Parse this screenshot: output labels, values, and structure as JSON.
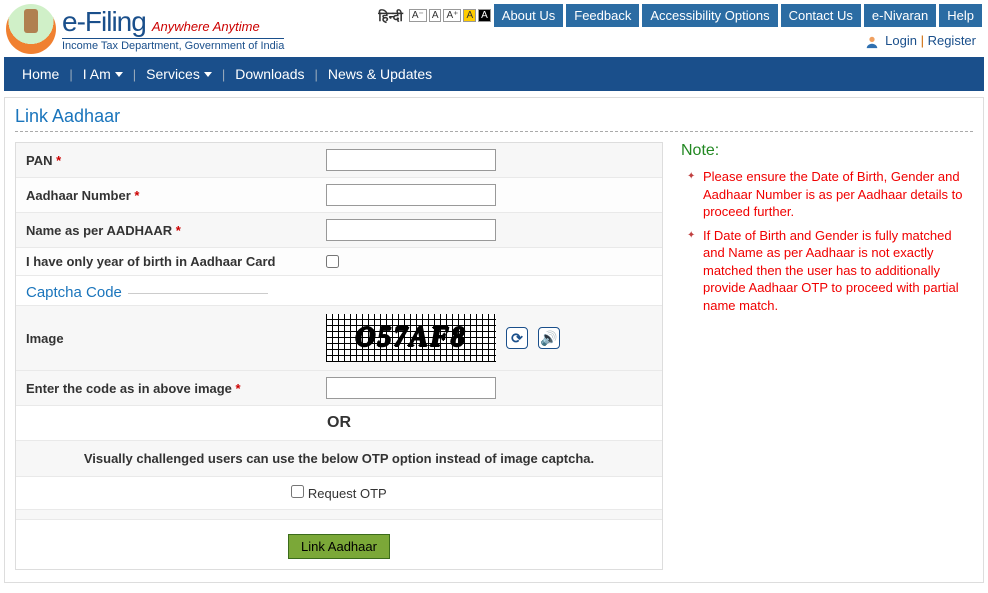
{
  "brand": {
    "efiling": "e-Filing",
    "tagline": "Anywhere Anytime",
    "sub": "Income Tax Department, Government of India"
  },
  "header": {
    "hindi": "हिन्दी",
    "font_minus": "A⁻",
    "font_a1": "A",
    "font_plus": "A⁺",
    "font_yellow": "A",
    "font_black": "A",
    "btns": {
      "about": "About Us",
      "feedback": "Feedback",
      "access": "Accessibility Options",
      "contact": "Contact Us",
      "enivaran": "e-Nivaran",
      "help": "Help"
    },
    "login": "Login",
    "register": "Register",
    "sep": "|"
  },
  "nav": {
    "home": "Home",
    "iam": "I Am",
    "services": "Services",
    "downloads": "Downloads",
    "news": "News & Updates"
  },
  "page_title": "Link Aadhaar",
  "form": {
    "pan": "PAN",
    "aadhaar": "Aadhaar Number",
    "name": "Name as per AADHAAR",
    "yob": "I have only year of birth in Aadhaar Card",
    "captcha_head": "Captcha Code",
    "image_label": "Image",
    "captcha_text": "O57AF8",
    "enter_code": "Enter the code as in above image",
    "or": "OR",
    "otp_msg": "Visually challenged users can use the below OTP option instead of image captcha.",
    "request_otp": "Request OTP",
    "submit": "Link Aadhaar",
    "star": "*"
  },
  "notes": {
    "title": "Note:",
    "items": [
      "Please ensure the Date of Birth, Gender and Aadhaar Number is as per Aadhaar details to proceed further.",
      "If Date of Birth and Gender is fully matched and Name as per Aadhaar is not exactly matched then the user has to additionally provide Aadhaar OTP to proceed with partial name match."
    ]
  }
}
